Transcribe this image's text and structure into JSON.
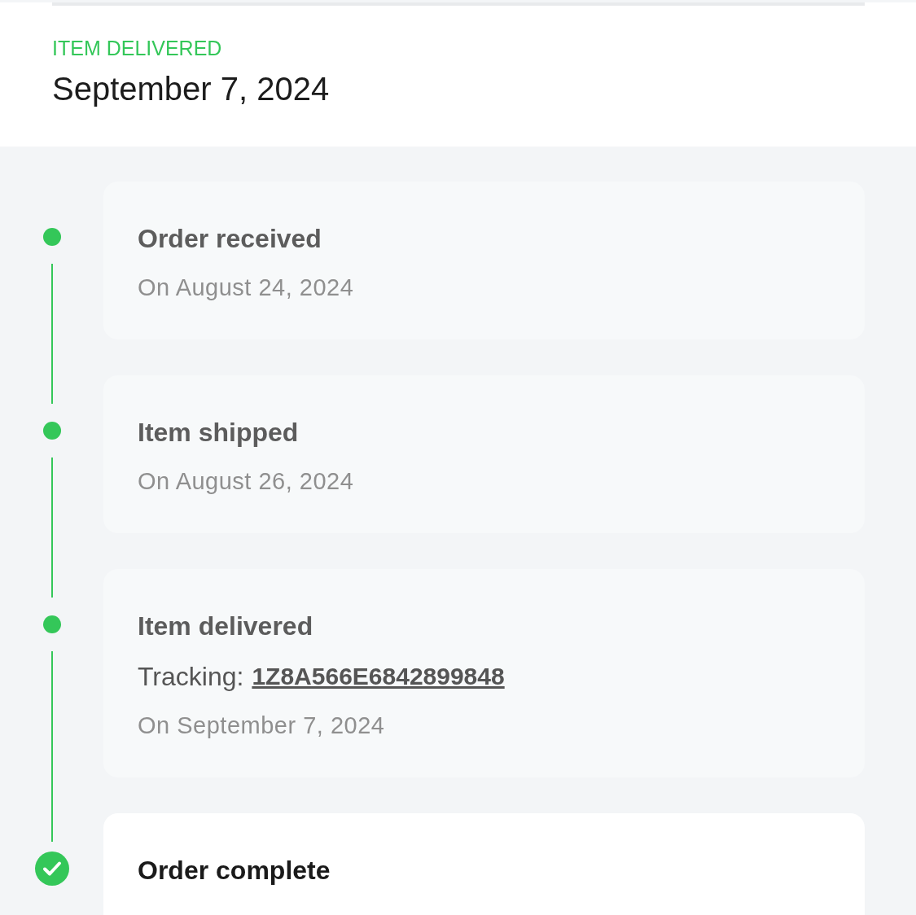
{
  "header": {
    "status": "ITEM DELIVERED",
    "date": "September 7, 2024"
  },
  "steps": [
    {
      "kind": "step",
      "title": "Order received",
      "date": "On August 24, 2024"
    },
    {
      "kind": "step",
      "title": "Item shipped",
      "date": "On August 26, 2024"
    },
    {
      "kind": "step",
      "title": "Item delivered",
      "tracking_label": "Tracking:",
      "tracking_number": "1Z8A566E6842899848",
      "date": "On September 7, 2024"
    },
    {
      "kind": "complete",
      "title": "Order complete"
    }
  ]
}
